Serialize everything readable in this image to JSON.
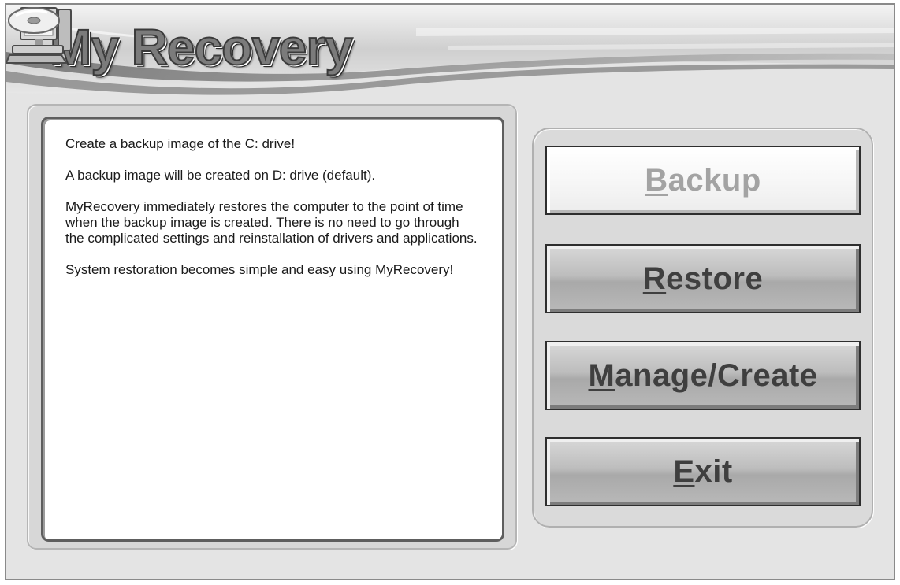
{
  "header": {
    "logo_text": "My Recovery",
    "logo_icons": [
      "computer-icon",
      "disc-icon"
    ]
  },
  "info": {
    "paragraphs": [
      "Create a backup image of the C: drive!",
      "A backup image will be created on D: drive (default).",
      "MyRecovery immediately restores the computer to the point of time when the backup image is created.  There is no need to go through the complicated settings and reinstallation of drivers and applications.",
      "System restoration becomes simple and easy using MyRecovery!"
    ]
  },
  "buttons": {
    "backup": {
      "mnemonic": "B",
      "rest": "ackup",
      "selected": true
    },
    "restore": {
      "mnemonic": "R",
      "rest": "estore",
      "selected": false
    },
    "manage": {
      "mnemonic": "M",
      "rest": "anage/Create",
      "selected": false
    },
    "exit": {
      "mnemonic": "E",
      "rest": "xit",
      "selected": false
    }
  },
  "colors": {
    "window_bg": "#e4e4e4",
    "button_text": "#3f3f3f",
    "selected_button_text": "#a3a3a3"
  }
}
